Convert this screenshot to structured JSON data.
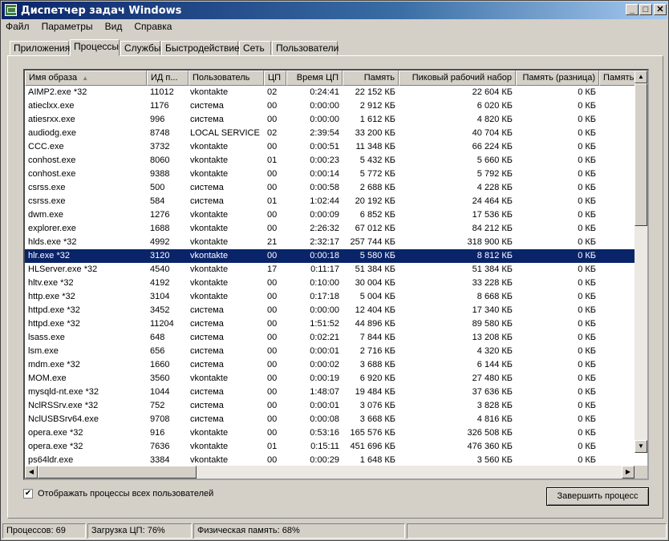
{
  "window": {
    "title": "Диспетчер задач Windows"
  },
  "menu": [
    "Файл",
    "Параметры",
    "Вид",
    "Справка"
  ],
  "tabs": [
    "Приложения",
    "Процессы",
    "Службы",
    "Быстродействие",
    "Сеть",
    "Пользователи"
  ],
  "active_tab": "Процессы",
  "columns": [
    "Имя образа",
    "ИД п...",
    "Пользователь",
    "ЦП",
    "Время ЦП",
    "Память",
    "Пиковый рабочий набор",
    "Память (разница)",
    "Память"
  ],
  "sorted_column": "Имя образа",
  "processes": [
    [
      "AIMP2.exe *32",
      "11012",
      "vkontakte",
      "02",
      "0:24:41",
      "22 152 КБ",
      "22 604 КБ",
      "0 КБ"
    ],
    [
      "atieclxx.exe",
      "1176",
      "система",
      "00",
      "0:00:00",
      "2 912 КБ",
      "6 020 КБ",
      "0 КБ"
    ],
    [
      "atiesrxx.exe",
      "996",
      "система",
      "00",
      "0:00:00",
      "1 612 КБ",
      "4 820 КБ",
      "0 КБ"
    ],
    [
      "audiodg.exe",
      "8748",
      "LOCAL SERVICE",
      "02",
      "2:39:54",
      "33 200 КБ",
      "40 704 КБ",
      "0 КБ"
    ],
    [
      "CCC.exe",
      "3732",
      "vkontakte",
      "00",
      "0:00:51",
      "11 348 КБ",
      "66 224 КБ",
      "0 КБ"
    ],
    [
      "conhost.exe",
      "8060",
      "vkontakte",
      "01",
      "0:00:23",
      "5 432 КБ",
      "5 660 КБ",
      "0 КБ"
    ],
    [
      "conhost.exe",
      "9388",
      "vkontakte",
      "00",
      "0:00:14",
      "5 772 КБ",
      "5 792 КБ",
      "0 КБ"
    ],
    [
      "csrss.exe",
      "500",
      "система",
      "00",
      "0:00:58",
      "2 688 КБ",
      "4 228 КБ",
      "0 КБ"
    ],
    [
      "csrss.exe",
      "584",
      "система",
      "01",
      "1:02:44",
      "20 192 КБ",
      "24 464 КБ",
      "0 КБ"
    ],
    [
      "dwm.exe",
      "1276",
      "vkontakte",
      "00",
      "0:00:09",
      "6 852 КБ",
      "17 536 КБ",
      "0 КБ"
    ],
    [
      "explorer.exe",
      "1688",
      "vkontakte",
      "00",
      "2:26:32",
      "67 012 КБ",
      "84 212 КБ",
      "0 КБ"
    ],
    [
      "hlds.exe *32",
      "4992",
      "vkontakte",
      "21",
      "2:32:17",
      "257 744 КБ",
      "318 900 КБ",
      "0 КБ"
    ],
    [
      "hlr.exe *32",
      "3120",
      "vkontakte",
      "00",
      "0:00:18",
      "5 580 КБ",
      "8 812 КБ",
      "0 КБ"
    ],
    [
      "HLServer.exe *32",
      "4540",
      "vkontakte",
      "17",
      "0:11:17",
      "51 384 КБ",
      "51 384 КБ",
      "0 КБ"
    ],
    [
      "hltv.exe *32",
      "4192",
      "vkontakte",
      "00",
      "0:10:00",
      "30 004 КБ",
      "33 228 КБ",
      "0 КБ"
    ],
    [
      "http.exe *32",
      "3104",
      "vkontakte",
      "00",
      "0:17:18",
      "5 004 КБ",
      "8 668 КБ",
      "0 КБ"
    ],
    [
      "httpd.exe *32",
      "3452",
      "система",
      "00",
      "0:00:00",
      "12 404 КБ",
      "17 340 КБ",
      "0 КБ"
    ],
    [
      "httpd.exe *32",
      "11204",
      "система",
      "00",
      "1:51:52",
      "44 896 КБ",
      "89 580 КБ",
      "0 КБ"
    ],
    [
      "lsass.exe",
      "648",
      "система",
      "00",
      "0:02:21",
      "7 844 КБ",
      "13 208 КБ",
      "0 КБ"
    ],
    [
      "lsm.exe",
      "656",
      "система",
      "00",
      "0:00:01",
      "2 716 КБ",
      "4 320 КБ",
      "0 КБ"
    ],
    [
      "mdm.exe *32",
      "1660",
      "система",
      "00",
      "0:00:02",
      "3 688 КБ",
      "6 144 КБ",
      "0 КБ"
    ],
    [
      "MOM.exe",
      "3560",
      "vkontakte",
      "00",
      "0:00:19",
      "6 920 КБ",
      "27 480 КБ",
      "0 КБ"
    ],
    [
      "mysqld-nt.exe *32",
      "1044",
      "система",
      "00",
      "1:48:07",
      "19 484 КБ",
      "37 636 КБ",
      "0 КБ"
    ],
    [
      "NclRSSrv.exe *32",
      "752",
      "система",
      "00",
      "0:00:01",
      "3 076 КБ",
      "3 828 КБ",
      "0 КБ"
    ],
    [
      "NclUSBSrv64.exe",
      "9708",
      "система",
      "00",
      "0:00:08",
      "3 668 КБ",
      "4 816 КБ",
      "0 КБ"
    ],
    [
      "opera.exe *32",
      "916",
      "vkontakte",
      "00",
      "0:53:16",
      "165 576 КБ",
      "326 508 КБ",
      "0 КБ"
    ],
    [
      "opera.exe *32",
      "7636",
      "vkontakte",
      "01",
      "0:15:11",
      "451 696 КБ",
      "476 360 КБ",
      "0 КБ"
    ],
    [
      "ps64ldr.exe",
      "3384",
      "vkontakte",
      "00",
      "0:00:29",
      "1 648 КБ",
      "3 560 КБ",
      "0 КБ"
    ]
  ],
  "selected_row": "hlr.exe *32",
  "show_all_users": {
    "label": "Отображать процессы всех пользователей",
    "checked": true
  },
  "end_process_button": "Завершить процесс",
  "status": {
    "processes": "Процессов: 69",
    "cpu": "Загрузка ЦП: 76%",
    "memory": "Физическая память: 68%"
  },
  "colors": {
    "title_start": "#0a246a",
    "title_end": "#a6caf0",
    "selection": "#0a246a",
    "face": "#d4d0c8"
  }
}
